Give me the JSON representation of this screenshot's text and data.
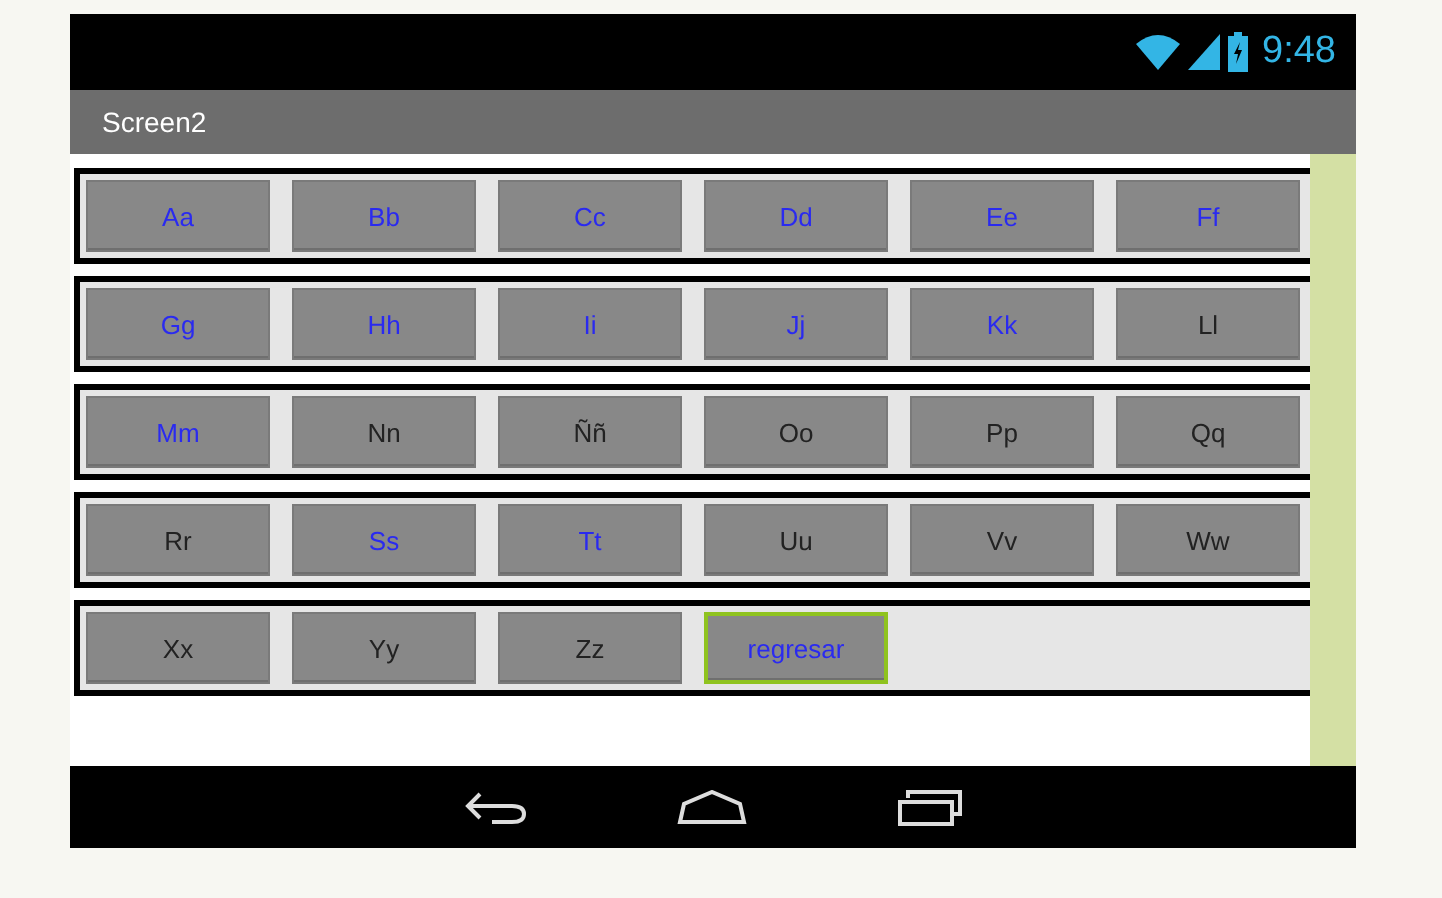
{
  "status_bar": {
    "time": "9:48"
  },
  "title_bar": {
    "title": "Screen2"
  },
  "rows": [
    {
      "buttons": [
        {
          "label": "Aa",
          "accent": true,
          "selected": false
        },
        {
          "label": "Bb",
          "accent": true,
          "selected": false
        },
        {
          "label": "Cc",
          "accent": true,
          "selected": false
        },
        {
          "label": "Dd",
          "accent": true,
          "selected": false
        },
        {
          "label": "Ee",
          "accent": true,
          "selected": false
        },
        {
          "label": "Ff",
          "accent": true,
          "selected": false
        }
      ]
    },
    {
      "buttons": [
        {
          "label": "Gg",
          "accent": true,
          "selected": false
        },
        {
          "label": "Hh",
          "accent": true,
          "selected": false
        },
        {
          "label": "Ii",
          "accent": true,
          "selected": false
        },
        {
          "label": "Jj",
          "accent": true,
          "selected": false
        },
        {
          "label": "Kk",
          "accent": true,
          "selected": false
        },
        {
          "label": "Ll",
          "accent": false,
          "selected": false
        }
      ]
    },
    {
      "buttons": [
        {
          "label": "Mm",
          "accent": true,
          "selected": false
        },
        {
          "label": "Nn",
          "accent": false,
          "selected": false
        },
        {
          "label": "Ññ",
          "accent": false,
          "selected": false
        },
        {
          "label": "Oo",
          "accent": false,
          "selected": false
        },
        {
          "label": "Pp",
          "accent": false,
          "selected": false
        },
        {
          "label": "Qq",
          "accent": false,
          "selected": false
        }
      ]
    },
    {
      "buttons": [
        {
          "label": "Rr",
          "accent": false,
          "selected": false
        },
        {
          "label": "Ss",
          "accent": true,
          "selected": false
        },
        {
          "label": "Tt",
          "accent": true,
          "selected": false
        },
        {
          "label": "Uu",
          "accent": false,
          "selected": false
        },
        {
          "label": "Vv",
          "accent": false,
          "selected": false
        },
        {
          "label": "Ww",
          "accent": false,
          "selected": false
        }
      ]
    },
    {
      "buttons": [
        {
          "label": "Xx",
          "accent": false,
          "selected": false
        },
        {
          "label": "Yy",
          "accent": false,
          "selected": false
        },
        {
          "label": "Zz",
          "accent": false,
          "selected": false
        },
        {
          "label": "regresar",
          "accent": true,
          "selected": true
        }
      ]
    }
  ]
}
